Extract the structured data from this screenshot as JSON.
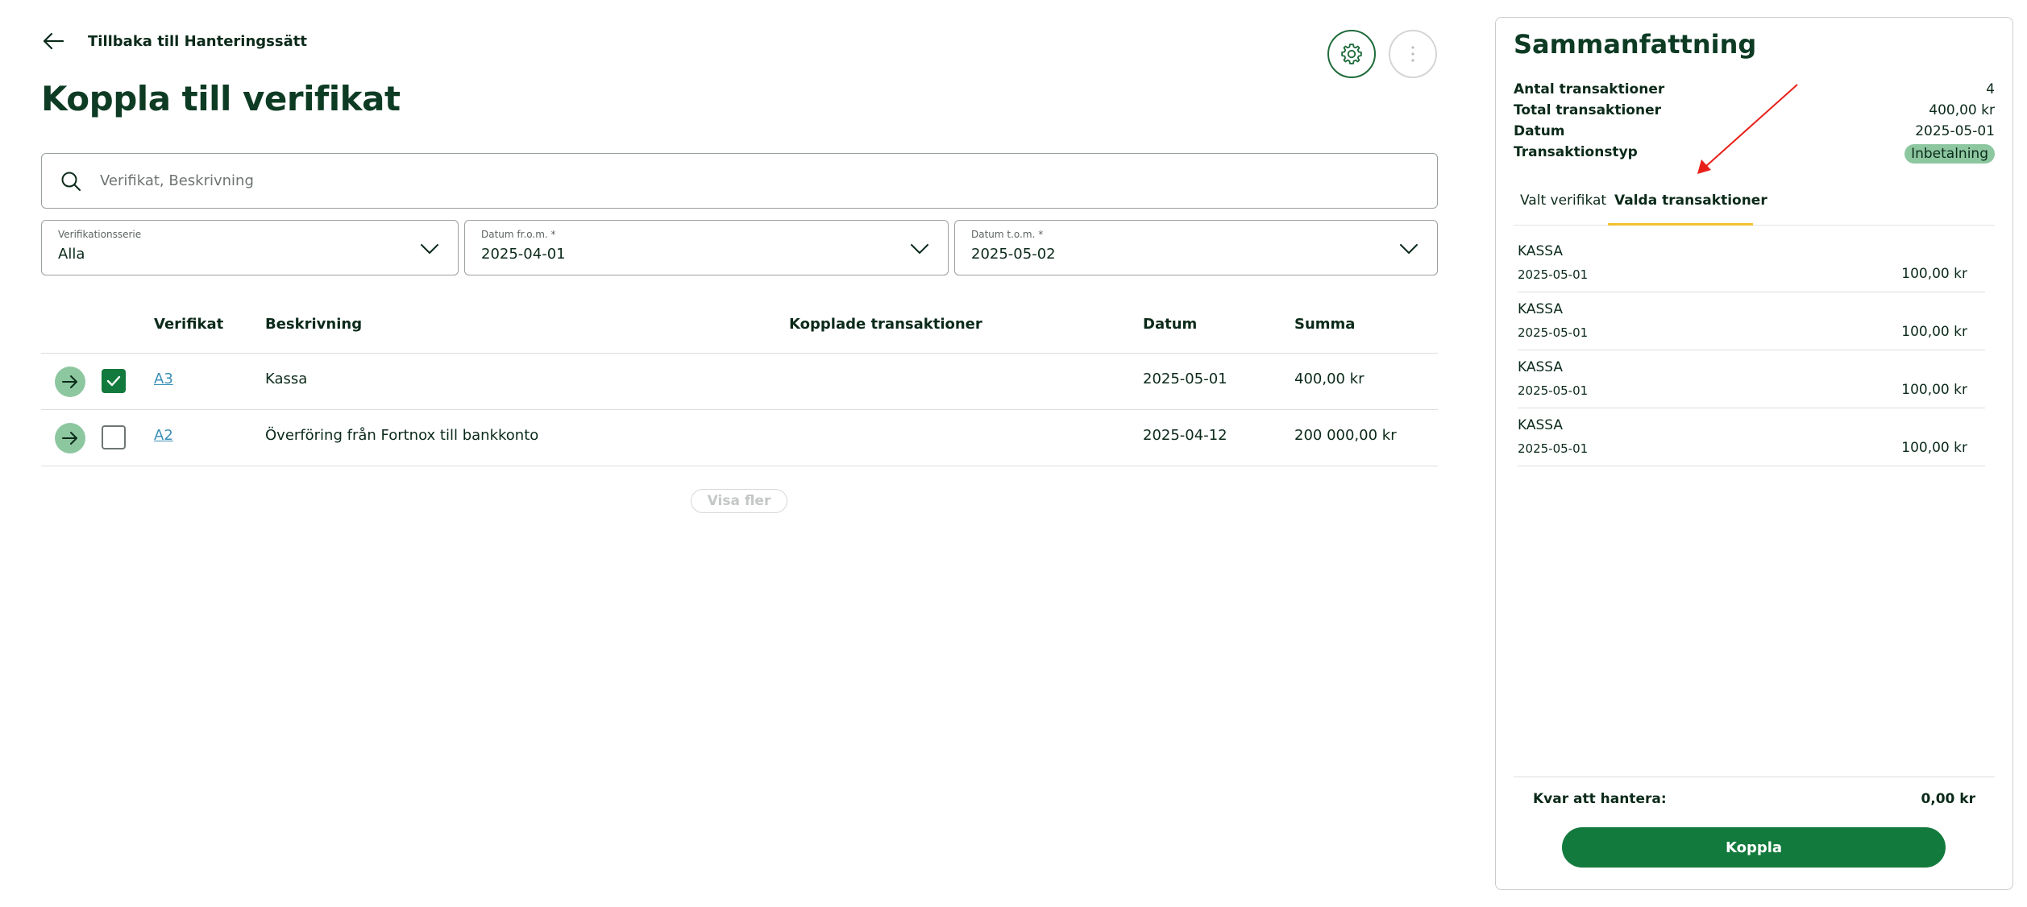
{
  "header": {
    "back_label": "Tillbaka till Hanteringssätt",
    "title": "Koppla till verifikat"
  },
  "search": {
    "placeholder": "Verifikat, Beskrivning",
    "value": ""
  },
  "filters": {
    "series": {
      "label": "Verifikationsserie",
      "value": "Alla"
    },
    "date_from": {
      "label": "Datum fr.o.m. *",
      "value": "2025-04-01"
    },
    "date_to": {
      "label": "Datum t.o.m. *",
      "value": "2025-05-02"
    }
  },
  "table": {
    "columns": [
      "Verifikat",
      "Beskrivning",
      "Kopplade transaktioner",
      "Datum",
      "Summa"
    ],
    "rows": [
      {
        "verifikat": "A3",
        "beskrivning": "Kassa",
        "kopplade": "",
        "datum": "2025-05-01",
        "summa": "400,00 kr",
        "checked": true
      },
      {
        "verifikat": "A2",
        "beskrivning": "Överföring från Fortnox till bankkonto",
        "kopplade": "",
        "datum": "2025-04-12",
        "summa": "200 000,00 kr",
        "checked": false
      }
    ],
    "show_more_label": "Visa fler"
  },
  "summary": {
    "title": "Sammanfattning",
    "rows": [
      {
        "label": "Antal transaktioner",
        "value": "4"
      },
      {
        "label": "Total transaktioner",
        "value": "400,00 kr"
      },
      {
        "label": "Datum",
        "value": "2025-05-01"
      },
      {
        "label": "Transaktionstyp",
        "value": "Inbetalning"
      }
    ],
    "tabs": [
      {
        "label": "Valt verifikat",
        "active": false
      },
      {
        "label": "Valda transaktioner",
        "active": true
      }
    ],
    "transactions": [
      {
        "name": "KASSA",
        "date": "2025-05-01",
        "amount": "100,00 kr"
      },
      {
        "name": "KASSA",
        "date": "2025-05-01",
        "amount": "100,00 kr"
      },
      {
        "name": "KASSA",
        "date": "2025-05-01",
        "amount": "100,00 kr"
      },
      {
        "name": "KASSA",
        "date": "2025-05-01",
        "amount": "100,00 kr"
      }
    ],
    "remaining_label": "Kvar att hantera:",
    "remaining_value": "0,00 kr",
    "connect_label": "Koppla"
  },
  "colors": {
    "brand_green": "#137a3d",
    "light_green": "#8dc7a0",
    "title_green": "#0d3b23",
    "link_blue": "#3a8fb7",
    "tab_underline_yellow": "#f2c12e",
    "annotation_red": "#e8201a"
  },
  "icons": [
    "back-arrow-icon",
    "gear-icon",
    "more-vertical-icon",
    "search-icon",
    "chevron-down-icon",
    "arrow-right-icon",
    "check-icon"
  ]
}
